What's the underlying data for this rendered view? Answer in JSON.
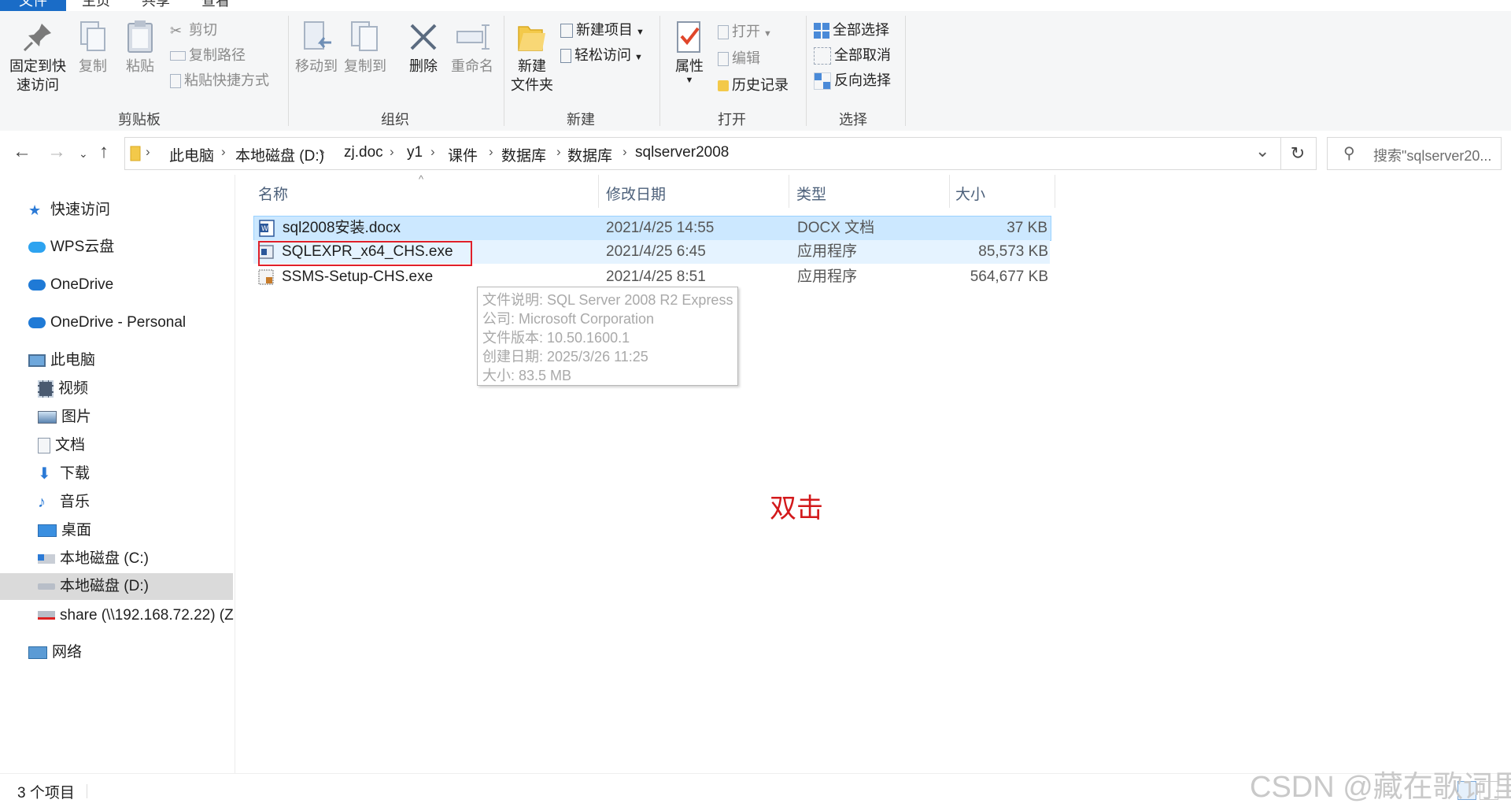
{
  "ribbon": {
    "tabs": [
      "文件",
      "主页",
      "共享",
      "查看"
    ],
    "clipboard": {
      "pin_label_1": "固定到快",
      "pin_label_2": "速访问",
      "copy_label": "复制",
      "paste_label": "粘贴",
      "cut_label": "剪切",
      "copy_path_label": "复制路径",
      "paste_shortcut_label": "粘贴快捷方式",
      "group_label": "剪贴板"
    },
    "organize": {
      "move_to_label": "移动到",
      "copy_to_label": "复制到",
      "delete_label": "删除",
      "rename_label": "重命名",
      "group_label": "组织"
    },
    "new": {
      "new_folder_label_1": "新建",
      "new_folder_label_2": "文件夹",
      "new_item_label": "新建项目",
      "easy_access_label": "轻松访问",
      "group_label": "新建"
    },
    "open": {
      "properties_label": "属性",
      "open_label": "打开",
      "edit_label": "编辑",
      "history_label": "历史记录",
      "group_label": "打开"
    },
    "select": {
      "select_all_label": "全部选择",
      "select_none_label": "全部取消",
      "invert_label": "反向选择",
      "group_label": "选择"
    }
  },
  "address": {
    "crumbs": [
      "此电脑",
      "本地磁盘 (D:)",
      "zj.doc",
      "y1",
      "课件",
      "数据库",
      "数据库",
      "sqlserver2008"
    ],
    "search_placeholder": "搜索\"sqlserver20..."
  },
  "navpane": {
    "items": [
      "快速访问",
      "WPS云盘",
      "OneDrive",
      "OneDrive - Personal",
      "此电脑",
      "视频",
      "图片",
      "文档",
      "下载",
      "音乐",
      "桌面",
      "本地磁盘 (C:)",
      "本地磁盘 (D:)",
      "share (\\\\192.168.72.22) (Z",
      "网络"
    ]
  },
  "filelist": {
    "columns": [
      "名称",
      "修改日期",
      "类型",
      "大小"
    ],
    "rows": [
      {
        "name": "sql2008安装.docx",
        "date": "2021/4/25 14:55",
        "type": "DOCX 文档",
        "size": "37 KB"
      },
      {
        "name": "SQLEXPR_x64_CHS.exe",
        "date": "2021/4/25 6:45",
        "type": "应用程序",
        "size": "85,573 KB"
      },
      {
        "name": "SSMS-Setup-CHS.exe",
        "date": "2021/4/25 8:51",
        "type": "应用程序",
        "size": "564,677 KB"
      }
    ]
  },
  "tooltip": {
    "lines": [
      "文件说明: SQL Server 2008 R2 Express",
      "公司: Microsoft Corporation",
      "文件版本: 10.50.1600.1",
      "创建日期: 2025/3/26 11:25",
      "大小: 83.5 MB"
    ]
  },
  "annotation": "双击",
  "status": {
    "item_count": "3 个项目"
  },
  "watermark": "CSDN @藏在歌词里",
  "colors": {
    "accent": "#1a6cc7",
    "selection": "#cce8ff",
    "hover": "#e5f3ff",
    "annotation_red": "#d3191b"
  }
}
